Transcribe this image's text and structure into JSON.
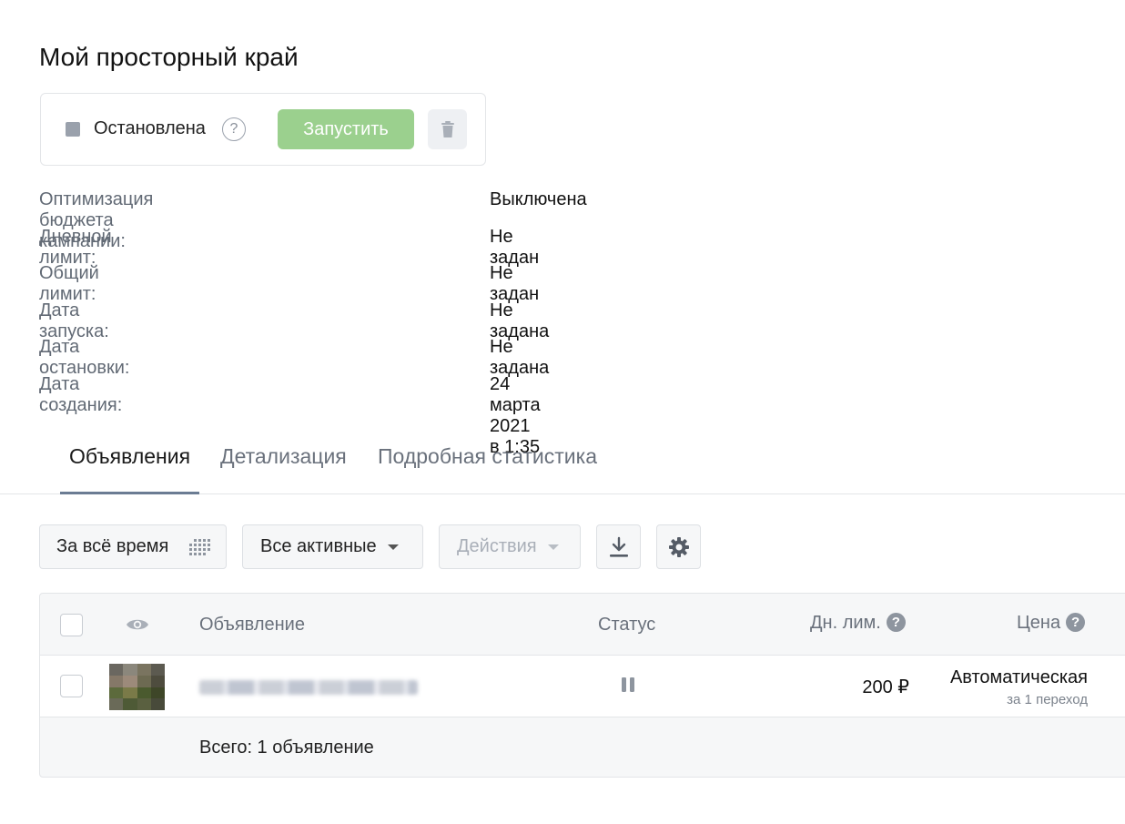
{
  "page": {
    "title": "Мой просторный край"
  },
  "status_card": {
    "status": "Остановлена",
    "help": "?",
    "launch_label": "Запустить",
    "status_color": "#9aa1ac",
    "launch_color": "#9bd08e"
  },
  "info": [
    {
      "label": "Оптимизация бюджета кампании:",
      "value": "Выключена"
    },
    {
      "label": "Дневной лимит:",
      "value": "Не задан"
    },
    {
      "label": "Общий лимит:",
      "value": "Не задан"
    },
    {
      "label": "Дата запуска:",
      "value": "Не задана"
    },
    {
      "label": "Дата остановки:",
      "value": "Не задана"
    },
    {
      "label": "Дата создания:",
      "value": "24 марта 2021 в 1:35"
    }
  ],
  "tabs": [
    {
      "label": "Объявления",
      "active": true
    },
    {
      "label": "Детализация",
      "active": false
    },
    {
      "label": "Подробная статистика",
      "active": false
    }
  ],
  "toolbar": {
    "period_label": "За всё время",
    "filter_label": "Все активные",
    "actions_label": "Действия"
  },
  "table": {
    "columns": {
      "ad": "Объявление",
      "status": "Статус",
      "daily_limit": "Дн. лим.",
      "price": "Цена"
    },
    "rows": [
      {
        "status_icon": "pause-icon",
        "daily_limit": "200 ₽",
        "price": "Автоматическая",
        "price_note": "за 1 переход"
      }
    ],
    "total": "Всего: 1 объявление"
  }
}
